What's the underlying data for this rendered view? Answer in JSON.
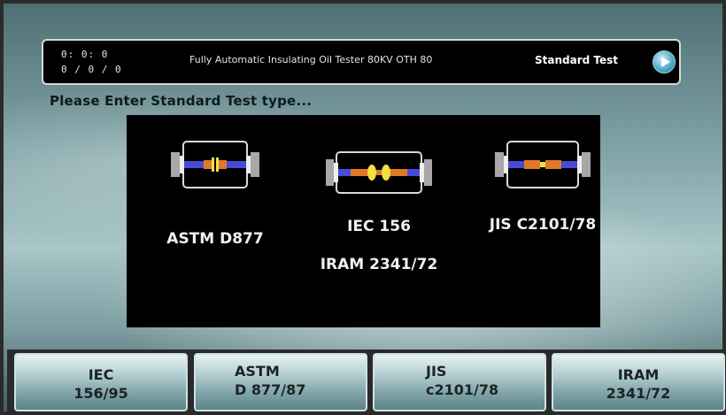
{
  "header": {
    "time": "0: 0: 0",
    "date": "0 / 0 / 0",
    "device_title": "Fully Automatic Insulating Oil Tester 80KV OTH 80",
    "mode_label": "Standard Test",
    "play_icon": "play-icon"
  },
  "prompt": "Please Enter Standard Test type...",
  "options": [
    {
      "line1": "ASTM D877",
      "icon": "electrode-cell-disc-icon"
    },
    {
      "line1": "IEC 156",
      "line2": "IRAM 2341/72",
      "icon": "electrode-cell-sphere-icon"
    },
    {
      "line1": "JIS C2101/78",
      "icon": "electrode-cell-icon"
    }
  ],
  "buttons": [
    {
      "line1": "IEC",
      "line2": "156/95"
    },
    {
      "line1": "ASTM",
      "line2": "D 877/87"
    },
    {
      "line1": "JIS",
      "line2": "c2101/78"
    },
    {
      "line1": "IRAM",
      "line2": "2341/72"
    }
  ],
  "colors": {
    "panel_bg": "#000000",
    "electrode_orange": "#e0782a",
    "electrode_blue": "#4a4ad8",
    "highlight_yellow": "#f0e040"
  }
}
